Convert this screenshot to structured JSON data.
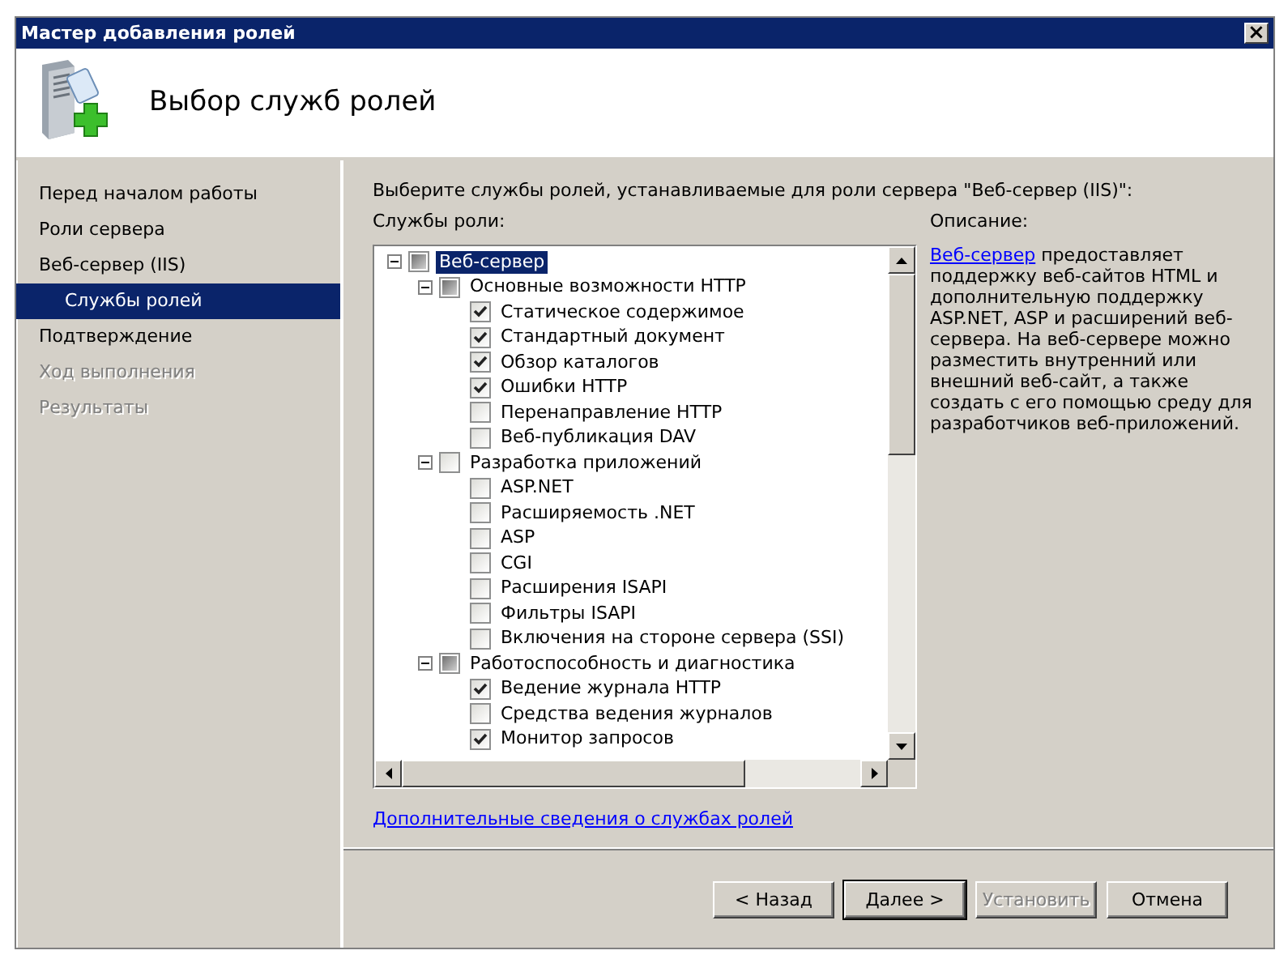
{
  "window": {
    "title": "Мастер добавления ролей",
    "close": "×"
  },
  "header": {
    "title": "Выбор служб ролей"
  },
  "sidebar": {
    "items": [
      {
        "label": "Перед началом работы",
        "selected": false,
        "disabled": false
      },
      {
        "label": "Роли сервера",
        "selected": false,
        "disabled": false
      },
      {
        "label": "Веб-сервер (IIS)",
        "selected": false,
        "disabled": false,
        "children": [
          {
            "label": "Службы ролей",
            "selected": true,
            "disabled": false
          }
        ]
      },
      {
        "label": "Подтверждение",
        "selected": false,
        "disabled": false
      },
      {
        "label": "Ход выполнения",
        "selected": false,
        "disabled": true
      },
      {
        "label": "Результаты",
        "selected": false,
        "disabled": true
      }
    ]
  },
  "instruction": "Выберите службы ролей, устанавливаемые для роли сервера \"Веб-сервер (IIS)\":",
  "services_label": "Службы роли:",
  "tree": [
    {
      "label": "Веб-сервер",
      "checked": false,
      "partial": true,
      "expanded": true,
      "selected": true,
      "children": [
        {
          "label": "Основные возможности HTTP",
          "checked": false,
          "partial": true,
          "expanded": true,
          "selected": false,
          "children": [
            {
              "label": "Статическое содержимое",
              "checked": true,
              "selected": false
            },
            {
              "label": "Стандартный документ",
              "checked": true,
              "selected": false
            },
            {
              "label": "Обзор каталогов",
              "checked": true,
              "selected": false
            },
            {
              "label": "Ошибки HTTP",
              "checked": true,
              "selected": false
            },
            {
              "label": "Перенаправление HTTP",
              "checked": false,
              "selected": false
            },
            {
              "label": "Веб-публикация DAV",
              "checked": false,
              "selected": false
            }
          ]
        },
        {
          "label": "Разработка приложений",
          "checked": false,
          "partial": false,
          "expanded": true,
          "selected": false,
          "children": [
            {
              "label": "ASP.NET",
              "checked": false,
              "selected": false
            },
            {
              "label": "Расширяемость .NET",
              "checked": false,
              "selected": false
            },
            {
              "label": "ASP",
              "checked": false,
              "selected": false
            },
            {
              "label": "CGI",
              "checked": false,
              "selected": false
            },
            {
              "label": "Расширения ISAPI",
              "checked": false,
              "selected": false
            },
            {
              "label": "Фильтры ISAPI",
              "checked": false,
              "selected": false
            },
            {
              "label": "Включения на стороне сервера (SSI)",
              "checked": false,
              "selected": false
            }
          ]
        },
        {
          "label": "Работоспособность и диагностика",
          "checked": false,
          "partial": true,
          "expanded": true,
          "selected": false,
          "children": [
            {
              "label": "Ведение журнала HTTP",
              "checked": true,
              "selected": false
            },
            {
              "label": "Средства ведения журналов",
              "checked": false,
              "selected": false
            },
            {
              "label": "Монитор запросов",
              "checked": true,
              "selected": false
            }
          ]
        }
      ]
    }
  ],
  "more_info_link": "Дополнительные сведения о службах ролей",
  "description": {
    "label": "Описание:",
    "link": "Веб-сервер",
    "text": " предоставляет поддержку веб-сайтов HTML и дополнительную поддержку ASP.NET, ASP и расширений веб-сервера. На веб-сервере можно разместить внутренний или внешний веб-сайт, а также создать с его помощью среду для разработчиков веб-приложений."
  },
  "buttons": [
    {
      "label": "< Назад",
      "disabled": false,
      "default": false
    },
    {
      "label": "Далее >",
      "disabled": false,
      "default": true
    },
    {
      "label": "Установить",
      "disabled": true,
      "default": false
    },
    {
      "label": "Отмена",
      "disabled": false,
      "default": false
    }
  ]
}
